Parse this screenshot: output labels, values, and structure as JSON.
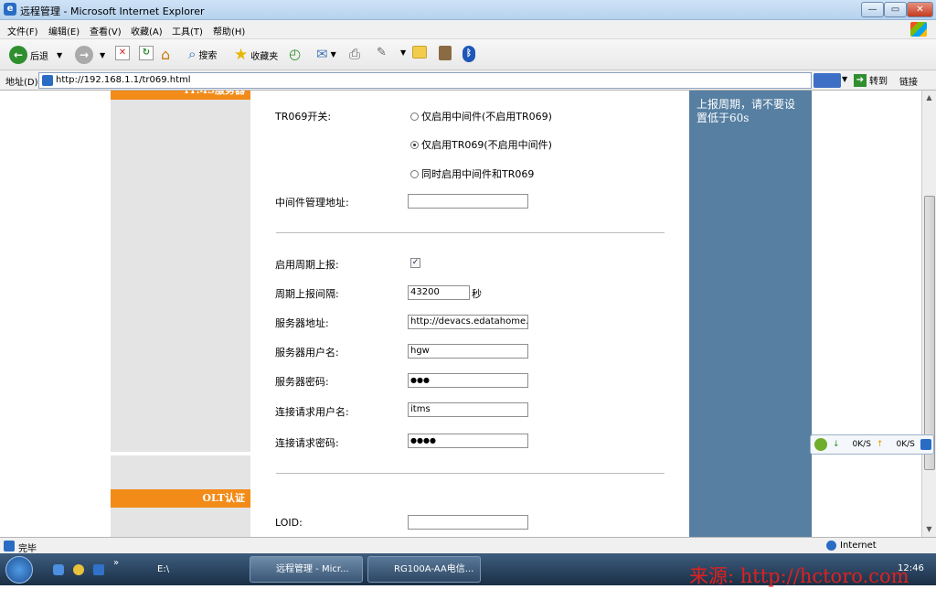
{
  "window": {
    "title": "远程管理 - Microsoft Internet Explorer"
  },
  "menu": [
    "文件(F)",
    "编辑(E)",
    "查看(V)",
    "收藏(A)",
    "工具(T)",
    "帮助(H)"
  ],
  "toolbar": {
    "back_label": "后退",
    "search_label": "搜索",
    "favorites_label": "收藏夹"
  },
  "address": {
    "label": "地址(D)",
    "url": "http://192.168.1.1/tr069.html",
    "go_label": "转到",
    "links_label": "链接"
  },
  "sidebar": {
    "section1": "ITMS服务器",
    "section2": "OLT认证"
  },
  "form": {
    "tr069_switch_label": "TR069开关:",
    "radio_options": [
      "仅启用中间件(不启用TR069)",
      "仅启用TR069(不启用中间件)",
      "同时启用中间件和TR069"
    ],
    "selected_radio": 1,
    "middleware_addr_label": "中间件管理地址:",
    "middleware_addr_value": "",
    "periodic_report_label": "启用周期上报:",
    "periodic_report_checked": true,
    "report_interval_label": "周期上报间隔:",
    "report_interval_value": "43200",
    "report_interval_unit": "秒",
    "server_addr_label": "服务器地址:",
    "server_addr_value": "http://devacs.edatahome.co",
    "server_user_label": "服务器用户名:",
    "server_user_value": "hgw",
    "server_pwd_label": "服务器密码:",
    "server_pwd_value": "●●●",
    "conn_user_label": "连接请求用户名:",
    "conn_user_value": "itms",
    "conn_pwd_label": "连接请求密码:",
    "conn_pwd_value": "●●●●",
    "loid_label": "LOID:",
    "loid_value": ""
  },
  "help": {
    "text": "上报周期，请不要设置低于60s"
  },
  "status": {
    "left": "完毕",
    "zone": "Internet"
  },
  "net_widget": {
    "down": "0K/S",
    "up": "0K/S"
  },
  "taskbar": {
    "item1": "E:\\",
    "item2": "远程管理 - Micr...",
    "item3": "RG100A-AA电信...",
    "clock": "12:46"
  },
  "watermark": "来源: http://hctoro.com"
}
